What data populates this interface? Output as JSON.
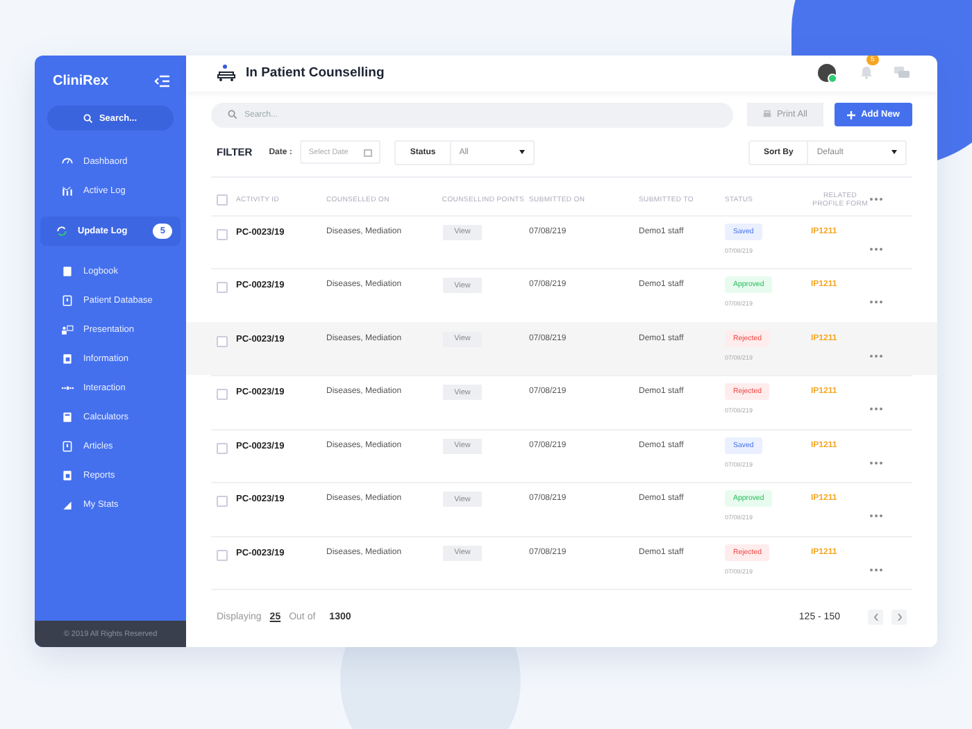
{
  "sidebar": {
    "brand": "CliniRex",
    "search_placeholder": "Search...",
    "items": [
      {
        "label": "Dashbaord",
        "selected": false
      },
      {
        "label": "Active Log",
        "selected": false
      },
      {
        "label": "Update Log",
        "selected": true,
        "badge": "5"
      },
      {
        "label": "Logbook",
        "selected": false
      },
      {
        "label": "Patient Database",
        "selected": false
      },
      {
        "label": "Presentation",
        "selected": false
      },
      {
        "label": "Information",
        "selected": false
      },
      {
        "label": "Interaction",
        "selected": false
      },
      {
        "label": "Calculators",
        "selected": false
      },
      {
        "label": "Articles",
        "selected": false
      },
      {
        "label": "Reports",
        "selected": false
      },
      {
        "label": "My Stats",
        "selected": false
      }
    ],
    "footer": "© 2019 All Rights Reserved"
  },
  "header": {
    "title": "In Patient Counselling",
    "notification_count": "5",
    "online": true
  },
  "toolbar": {
    "search_placeholder": "Search...",
    "print_button": "Print All",
    "add_button": "Add New"
  },
  "filter": {
    "label": "FILTER",
    "date_label": "Date :",
    "date_placeholder": "Select Date",
    "status_label": "Status",
    "status_value": "All",
    "sort_label": "Sort By",
    "sort_value": "Default"
  },
  "table": {
    "select_all_checked": false,
    "columns": [
      "ACTIVITY ID",
      "COUNSELLED ON",
      "COUNSELLIND POINTS",
      "SUBMITTED ON",
      "SUBMITTED TO",
      "STATUS",
      "RELATED PROFILE FORM"
    ],
    "rows": [
      {
        "id": "PC-0023/19",
        "counselled_on": "Diseases, Mediation",
        "points": "View",
        "submitted_on": "07/08/219",
        "submitted_to": "Demo1 staff",
        "status": "Saved",
        "kind": "saved",
        "status_date": "07/08/219",
        "form": "IP1211",
        "selected": false,
        "checked": false
      },
      {
        "id": "PC-0023/19",
        "counselled_on": "Diseases, Mediation",
        "points": "View",
        "submitted_on": "07/08/219",
        "submitted_to": "Demo1 staff",
        "status": "Approved",
        "kind": "approved",
        "status_date": "07/08/219",
        "form": "IP1211",
        "selected": false,
        "checked": false
      },
      {
        "id": "PC-0023/19",
        "counselled_on": "Diseases, Mediation",
        "points": "View",
        "submitted_on": "07/08/219",
        "submitted_to": "Demo1 staff",
        "status": "Rejected",
        "kind": "rejected",
        "status_date": "07/08/219",
        "form": "IP1211",
        "selected": true,
        "checked": false
      },
      {
        "id": "PC-0023/19",
        "counselled_on": "Diseases, Mediation",
        "points": "View",
        "submitted_on": "07/08/219",
        "submitted_to": "Demo1 staff",
        "status": "Rejected",
        "kind": "rejected",
        "status_date": "07/08/219",
        "form": "IP1211",
        "selected": false,
        "checked": false
      },
      {
        "id": "PC-0023/19",
        "counselled_on": "Diseases, Mediation",
        "points": "View",
        "submitted_on": "07/08/219",
        "submitted_to": "Demo1 staff",
        "status": "Saved",
        "kind": "saved",
        "status_date": "07/08/219",
        "form": "IP1211",
        "selected": false,
        "checked": false
      },
      {
        "id": "PC-0023/19",
        "counselled_on": "Diseases, Mediation",
        "points": "View",
        "submitted_on": "07/08/219",
        "submitted_to": "Demo1 staff",
        "status": "Approved",
        "kind": "approved",
        "status_date": "07/08/219",
        "form": "IP1211",
        "selected": false,
        "checked": false
      },
      {
        "id": "PC-0023/19",
        "counselled_on": "Diseases, Mediation",
        "points": "View",
        "submitted_on": "07/08/219",
        "submitted_to": "Demo1 staff",
        "status": "Rejected",
        "kind": "rejected",
        "status_date": "07/08/219",
        "form": "IP1211",
        "selected": false,
        "checked": false
      }
    ]
  },
  "pagination": {
    "displaying_label": "Displaying",
    "page_size": "25",
    "out_of_label": "Out of",
    "total": "1300",
    "range": "125 - 150"
  }
}
